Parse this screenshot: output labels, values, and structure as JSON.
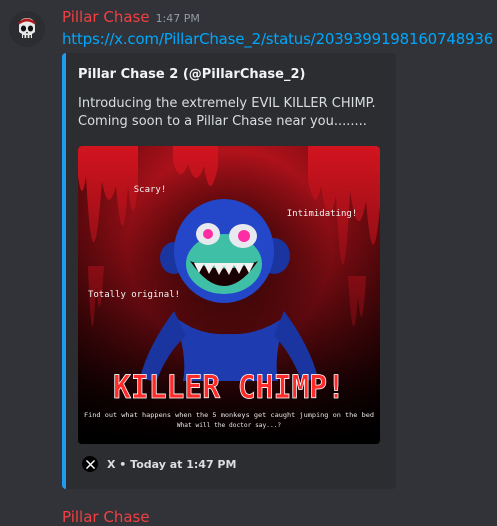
{
  "message": {
    "username": "Pillar Chase",
    "timestamp": "1:47 PM",
    "link": "https://x.com/PillarChase_2/status/2039399198160748936",
    "avatar_icon": "skull-icon"
  },
  "embed": {
    "accent_color": "#1d9bf0",
    "author": "Pillar Chase 2 (@PillarChase_2)",
    "description_line1": "Introducing the extremely EVIL KILLER CHIMP.",
    "description_line2": "Coming soon to a Pillar Chase near you........",
    "image": {
      "label_scary": "Scary!",
      "label_intimidating": "Intimidating!",
      "label_original": "Totally original!",
      "headline": "KILLER CHIMP!",
      "caption1": "Find out what happens when the 5 monkeys get caught jumping on the bed",
      "caption2": "What will the doctor say...?"
    },
    "footer": {
      "icon": "x-logo-icon",
      "text": "X • Today at 1:47 PM"
    }
  },
  "next_message": {
    "username": "Pillar Chase"
  }
}
